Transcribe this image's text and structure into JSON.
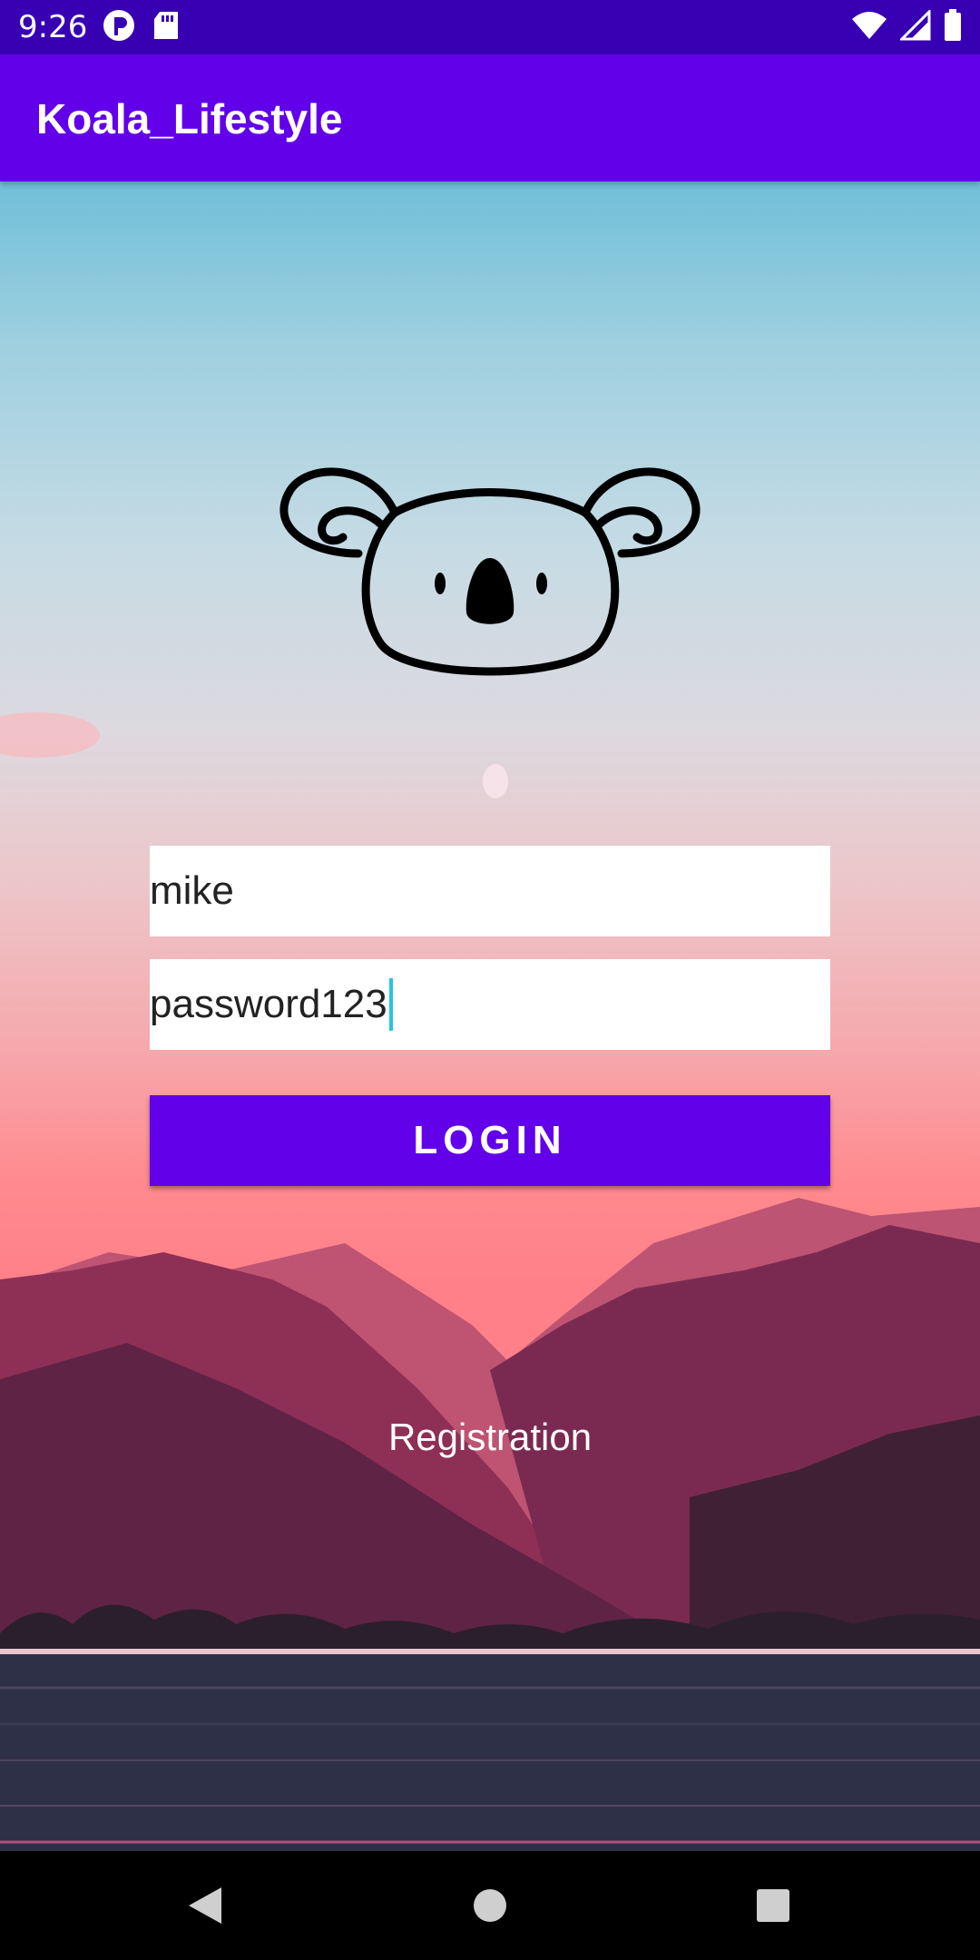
{
  "status_bar": {
    "time": "9:26",
    "left_icons": [
      "p-badge-icon",
      "sd-card-icon"
    ],
    "right_icons": [
      "wifi-icon",
      "cell-signal-icon",
      "battery-icon"
    ]
  },
  "app_bar": {
    "title": "Koala_Lifestyle",
    "color": "#6200ea"
  },
  "logo": {
    "icon": "koala-icon"
  },
  "form": {
    "username_value": "mike",
    "password_value": "password123",
    "login_label": "LOGIN",
    "registration_label": "Registration"
  },
  "nav_bar": {
    "buttons": [
      "back-icon",
      "home-icon",
      "recents-icon"
    ]
  },
  "colors": {
    "primary": "#6200ea",
    "status_bar": "#3700b3",
    "cursor": "#26c6da"
  }
}
